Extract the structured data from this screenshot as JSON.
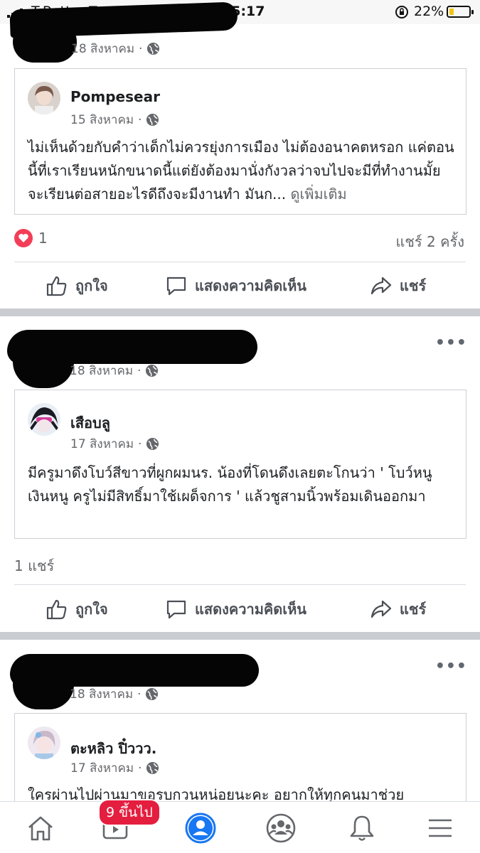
{
  "status_bar": {
    "carrier": "T:Better Together",
    "time": "15:17",
    "battery": "22%",
    "battery_level": 0.22
  },
  "posts": [
    {
      "date": "18 สิงหาคม",
      "shared": {
        "name": "Pompesear",
        "date": "15 สิงหาคม",
        "text": "ไม่เห็นด้วยกับคำว่าเด็กไม่ควรยุ่งการเมือง ไม่ต้องอนาคตหรอก แค่ตอนนี้ที่เราเรียนหนักขนาดนี้แต่ยังต้องมานั่งกังวลว่าจบไปจะมีที่ทำงานมั้ย จะเรียนต่อสายอะไรดีถึงจะมีงานทำ มันก...",
        "see_more": "ดูเพิ่มเติม"
      },
      "reaction_count": "1",
      "shares": "แชร์ 2 ครั้ง"
    },
    {
      "date": "18 สิงหาคม",
      "shared": {
        "name": "เสือบลู",
        "date": "17 สิงหาคม",
        "text": "มีครูมาดึงโบว์สีขาวที่ผูกผมนร. น้องที่โดนดึงเลยตะโกนว่า ' โบว์หนู เงินหนู ครูไม่มีสิทธิ์มาใช้เผด็จการ ' แล้วชูสามนิ้วพร้อมเดินออกมา"
      },
      "shares": "1 แชร์"
    },
    {
      "date": "18 สิงหาคม",
      "shared": {
        "name": "ตะหลิว ปิ๋ววว.",
        "date": "17 สิงหาคม",
        "text_before": "ใครผ่านไปผ่านมา",
        "text_link": "ขอรบกวนหน่อย",
        "text_after": "นะคะ อยากให้ทุกคนมาช่วย"
      }
    }
  ],
  "actions": {
    "like": "ถูกใจ",
    "comment": "แสดงความคิดเห็น",
    "share": "แชร์"
  },
  "more_label": "•••",
  "tabbar": {
    "badge": "9 ขึ้นไป",
    "icons": [
      "home-icon",
      "video-icon",
      "profile-icon",
      "groups-icon",
      "bell-icon",
      "menu-icon"
    ]
  },
  "colors": {
    "accent": "#1877f2",
    "reaction_heart": "#f33e58",
    "badge": "#e41e3f",
    "separator": "#c9ccd1"
  }
}
